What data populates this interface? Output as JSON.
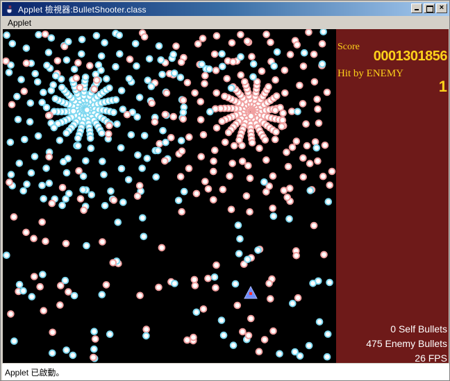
{
  "window": {
    "title": "Applet 檢視器:BulletShooter.class",
    "menu": [
      "Applet"
    ]
  },
  "panel": {
    "score_label": "Score",
    "score_value": "0001301856",
    "hit_label": "Hit by ENEMY",
    "hit_value": "1",
    "self_bullets": "0  Self Bullets",
    "enemy_bullets": "475 Enemy Bullets",
    "fps": "26 FPS"
  },
  "status": {
    "text": "Applet 已啟動。"
  },
  "colors": {
    "panel_bg": "#6e1a19",
    "score_text": "#ffd21a",
    "blue_bullet": "#7fd8f0",
    "red_bullet": "#f0a0a0",
    "player_ship": "#6f8cff"
  },
  "icons": {
    "title_icon": "java-cup-icon",
    "minimize": "minimize-icon",
    "maximize": "maximize-icon",
    "close": "close-icon",
    "player": "player-ship-icon"
  }
}
